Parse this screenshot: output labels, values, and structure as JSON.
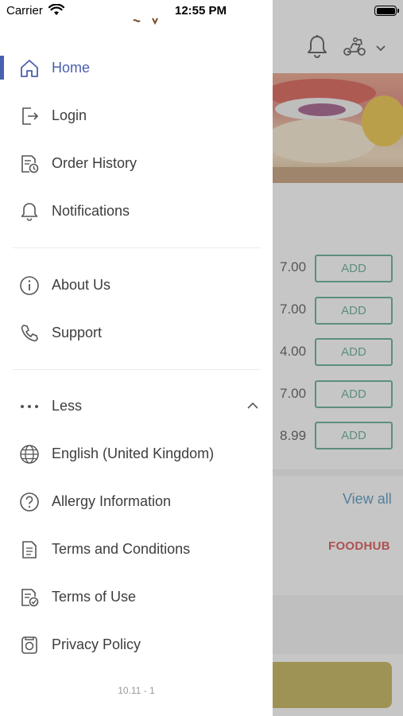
{
  "status_bar": {
    "carrier": "Carrier",
    "time": "12:55 PM"
  },
  "drawer": {
    "primary_items": [
      {
        "label": "Home",
        "icon": "home-icon",
        "active": true
      },
      {
        "label": "Login",
        "icon": "login-icon"
      },
      {
        "label": "Order History",
        "icon": "order-history-icon"
      },
      {
        "label": "Notifications",
        "icon": "bell-icon"
      }
    ],
    "secondary_items": [
      {
        "label": "About Us",
        "icon": "info-icon"
      },
      {
        "label": "Support",
        "icon": "phone-icon"
      }
    ],
    "more_toggle": {
      "label": "Less",
      "icon": "more-dots-icon",
      "expanded": true
    },
    "extra_items": [
      {
        "label": "English (United Kingdom)",
        "icon": "globe-icon"
      },
      {
        "label": "Allergy Information",
        "icon": "question-icon"
      },
      {
        "label": "Terms and Conditions",
        "icon": "document-icon"
      },
      {
        "label": "Terms of Use",
        "icon": "document-check-icon"
      },
      {
        "label": "Privacy Policy",
        "icon": "privacy-icon"
      }
    ],
    "version": "10.11 - 1"
  },
  "background_screen": {
    "prices": [
      "7.00",
      "7.00",
      "4.00",
      "7.00",
      "8.99"
    ],
    "add_label": "ADD",
    "view_all": "View all",
    "brand": "FOODHUB"
  },
  "colors": {
    "accent": "#4a5fae",
    "add_button": "#3f9a7c",
    "view_all": "#2f7fb0",
    "brand_red": "#d42b2b",
    "cart_bar": "#b6a132"
  }
}
